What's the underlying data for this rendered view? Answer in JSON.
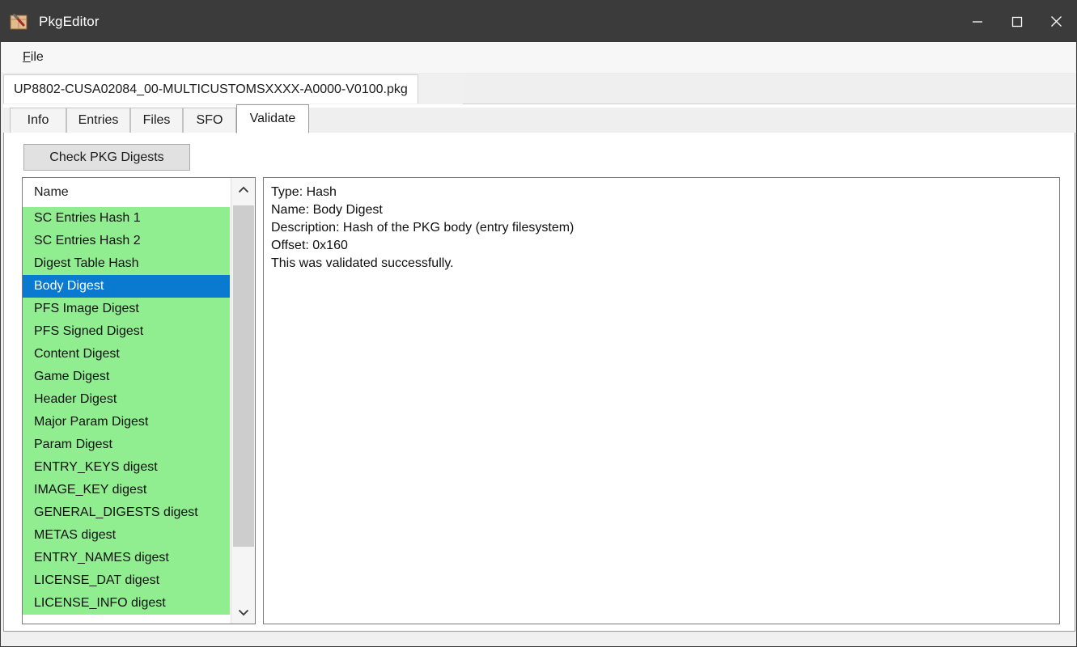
{
  "window": {
    "title": "PkgEditor",
    "icon": "package-hammer-icon",
    "minimize_label": "─",
    "maximize_label": "□",
    "close_label": "✕",
    "titlebar_color": "#3b3b3b"
  },
  "menu": {
    "items": [
      {
        "label": "File",
        "accel": "F"
      }
    ]
  },
  "file_tabs": [
    {
      "label": "UP8802-CUSA02084_00-MULTICUSTOMSXXXX-A0000-V0100.pkg",
      "selected": true
    }
  ],
  "inner_tabs": [
    {
      "label": "Info",
      "selected": false
    },
    {
      "label": "Entries",
      "selected": false
    },
    {
      "label": "Files",
      "selected": false
    },
    {
      "label": "SFO",
      "selected": false
    },
    {
      "label": "Validate",
      "selected": true
    }
  ],
  "toolbar": {
    "check_digests_label": "Check PKG Digests"
  },
  "list": {
    "header": "Name",
    "selected_index": 3,
    "row_bg_ok": "#90ee90",
    "row_bg_selected": "#0a79d0",
    "items": [
      {
        "label": "SC Entries Hash 1",
        "status": "ok"
      },
      {
        "label": "SC Entries Hash 2",
        "status": "ok"
      },
      {
        "label": "Digest Table Hash",
        "status": "ok"
      },
      {
        "label": "Body Digest",
        "status": "ok"
      },
      {
        "label": "PFS Image Digest",
        "status": "ok"
      },
      {
        "label": "PFS Signed Digest",
        "status": "ok"
      },
      {
        "label": "Content Digest",
        "status": "ok"
      },
      {
        "label": "Game Digest",
        "status": "ok"
      },
      {
        "label": "Header Digest",
        "status": "ok"
      },
      {
        "label": "Major Param Digest",
        "status": "ok"
      },
      {
        "label": "Param Digest",
        "status": "ok"
      },
      {
        "label": "ENTRY_KEYS digest",
        "status": "ok"
      },
      {
        "label": "IMAGE_KEY digest",
        "status": "ok"
      },
      {
        "label": "GENERAL_DIGESTS digest",
        "status": "ok"
      },
      {
        "label": "METAS digest",
        "status": "ok"
      },
      {
        "label": "ENTRY_NAMES digest",
        "status": "ok"
      },
      {
        "label": "LICENSE_DAT digest",
        "status": "ok"
      },
      {
        "label": "LICENSE_INFO digest",
        "status": "ok"
      }
    ]
  },
  "detail": {
    "lines": [
      "Type: Hash",
      "Name: Body Digest",
      "Description: Hash of the PKG body (entry filesystem)",
      "Offset: 0x160",
      "This was validated successfully."
    ]
  }
}
